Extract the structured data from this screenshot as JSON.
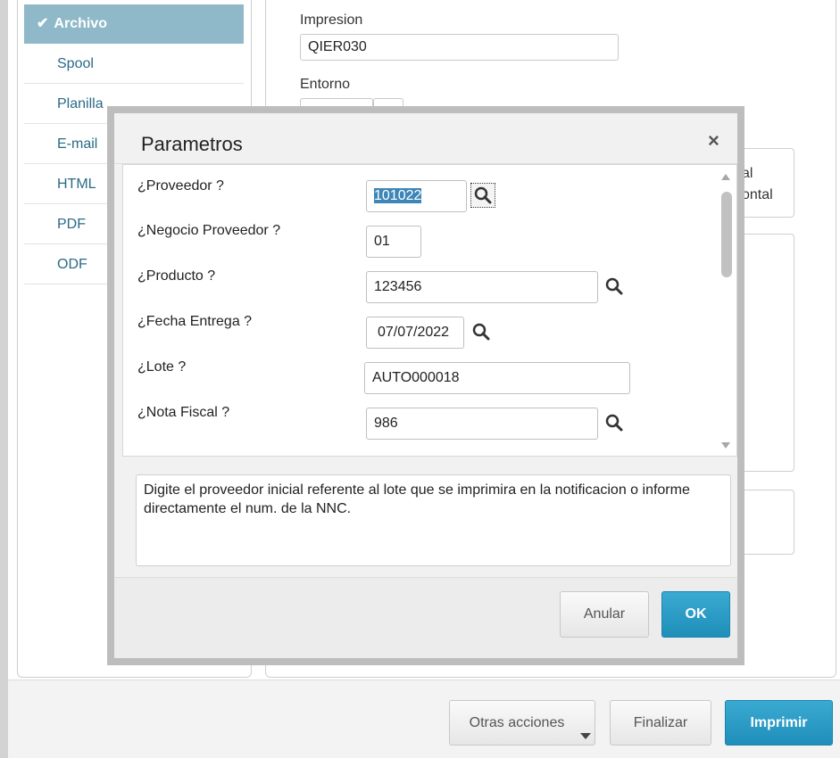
{
  "sidebar": {
    "items": [
      {
        "label": "Archivo",
        "check": "✔",
        "active": true
      },
      {
        "label": "Spool"
      },
      {
        "label": "Planilla"
      },
      {
        "label": "E-mail"
      },
      {
        "label": "HTML"
      },
      {
        "label": "PDF"
      },
      {
        "label": "ODF"
      }
    ]
  },
  "main": {
    "impresion_label": "Impresion",
    "impresion_value": "QIER030",
    "entorno_label": "Entorno",
    "orientation_partial_1": "al",
    "orientation_partial_2": "ontal"
  },
  "footer": {
    "otras_acciones": "Otras acciones",
    "finalizar": "Finalizar",
    "imprimir": "Imprimir"
  },
  "modal": {
    "title": "Parametros",
    "close": "×",
    "params": [
      {
        "label": "¿Proveedor ?",
        "value": "101022"
      },
      {
        "label": "¿Negocio Proveedor ?",
        "value": "01"
      },
      {
        "label": "¿Producto ?",
        "value": "123456"
      },
      {
        "label": "¿Fecha Entrega ?",
        "value": "07/07/2022"
      },
      {
        "label": "¿Lote ?",
        "value": "AUTO000018"
      },
      {
        "label": "¿Nota Fiscal ?",
        "value": "986"
      }
    ],
    "help_text": "Digite el proveedor inicial referente al lote que se imprimira en la notificacion o informe directamente el num. de la NNC.",
    "cancel": "Anular",
    "ok": "OK"
  },
  "colors": {
    "accent": "#1f8fba",
    "sidebar_active": "#8fb9c8",
    "sidebar_text": "#2a6a86",
    "selection": "#3e86b8"
  }
}
